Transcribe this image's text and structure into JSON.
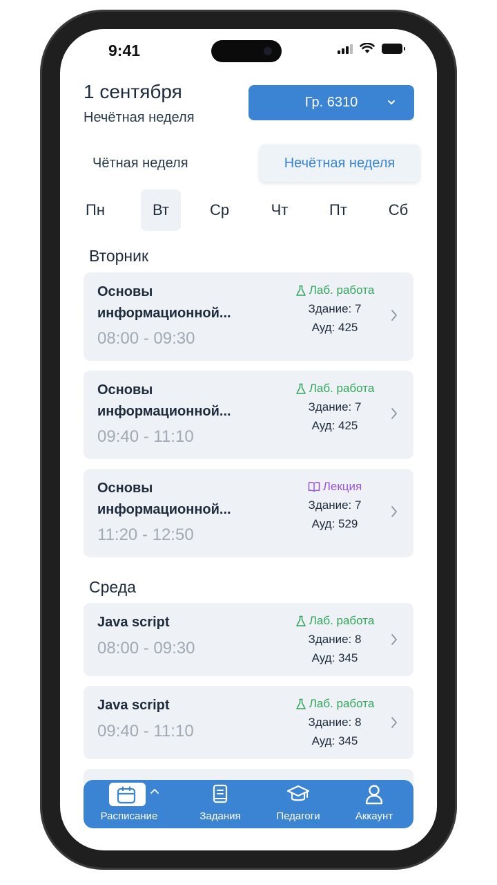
{
  "status_bar": {
    "time": "9:41"
  },
  "header": {
    "date": "1 сентября",
    "parity": "Нечётная неделя",
    "group_label": "Гр. 6310"
  },
  "week_toggle": {
    "even_label": "Чётная неделя",
    "odd_label": "Нечётная неделя",
    "selected": "odd"
  },
  "days": [
    {
      "label": "Пн",
      "active": false
    },
    {
      "label": "Вт",
      "active": true
    },
    {
      "label": "Ср",
      "active": false
    },
    {
      "label": "Чт",
      "active": false
    },
    {
      "label": "Пт",
      "active": false
    },
    {
      "label": "Сб",
      "active": false
    }
  ],
  "sections": [
    {
      "day": "Вторник",
      "classes": [
        {
          "title_line1": "Основы",
          "title_line2": "информационной...",
          "time": "08:00 - 09:30",
          "type": "Лаб. работа",
          "type_kind": "lab",
          "building": "Здание: 7",
          "room": "Ауд: 425"
        },
        {
          "title_line1": "Основы",
          "title_line2": "информационной...",
          "time": "09:40 - 11:10",
          "type": "Лаб. работа",
          "type_kind": "lab",
          "building": "Здание: 7",
          "room": "Ауд: 425"
        },
        {
          "title_line1": "Основы",
          "title_line2": "информационной...",
          "time": "11:20 - 12:50",
          "type": "Лекция",
          "type_kind": "lecture",
          "building": "Здание: 7",
          "room": "Ауд: 529"
        }
      ]
    },
    {
      "day": "Среда",
      "classes": [
        {
          "title_line1": "Java script",
          "time": "08:00 - 09:30",
          "type": "Лаб. работа",
          "type_kind": "lab",
          "building": "Здание: 8",
          "room": "Ауд: 345"
        },
        {
          "title_line1": "Java script",
          "time": "09:40 - 11:10",
          "type": "Лаб. работа",
          "type_kind": "lab",
          "building": "Здание: 8",
          "room": "Ауд: 345"
        }
      ]
    }
  ],
  "bottom_nav": [
    {
      "label": "Расписание",
      "icon": "calendar-icon",
      "active": true
    },
    {
      "label": "Задания",
      "icon": "book-icon",
      "active": false
    },
    {
      "label": "Педагоги",
      "icon": "graduation-cap-icon",
      "active": false
    },
    {
      "label": "Аккаунт",
      "icon": "user-icon",
      "active": false
    }
  ],
  "colors": {
    "accent": "#3a84d3",
    "lab": "#31a45a",
    "lecture": "#9a55d6",
    "card": "#eef2f6"
  }
}
